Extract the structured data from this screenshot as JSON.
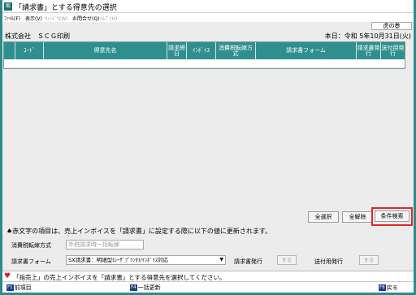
{
  "window": {
    "icon_label": "販",
    "title": "「請求書」とする得意先の選択"
  },
  "menu": {
    "file": "ﾌｧｲﾙ(F)",
    "view": "表示(V)",
    "window": "ｳｨﾝﾄﾞｳ(W)",
    "inquiry": "お問合せ(Q)",
    "help": "ﾍﾙﾌﾟ(H)"
  },
  "header": {
    "tiger_label": "虎の巻",
    "company": "株式会社　ＳＣＧ印刷",
    "date": "本日：令和 5年10月31日(火)"
  },
  "table": {
    "columns": [
      "ｺｰﾄﾞ",
      "得意先名",
      "請求締日",
      "ｲﾝﾎﾞｲｽ",
      "消費税転嫁方式",
      "請求書フォーム",
      "請求書発行",
      "送付用発行"
    ],
    "rows": []
  },
  "buttons": {
    "select_all": "全選択",
    "clear_all": "全解除",
    "condition_search": "条件検索"
  },
  "notice": "♠赤文字の項目は、売上インボイスを「請求書」に設定する際に以下の値に更新されます。",
  "form": {
    "tax_method_label": "消費税転嫁方式",
    "tax_method_value": "外税請求時一括転嫁",
    "invoice_form_label": "請求書フォーム",
    "invoice_form_value": "SX請求書：明細型(ﾚｰｻﾞﾌﾟﾘﾝﾀ)/ｲﾝﾎﾞｲｽ対応",
    "invoice_issue_label": "請求書発行",
    "invoice_issue_value": "する",
    "send_issue_label": "送付用発行",
    "send_issue_value": "する"
  },
  "status": {
    "message": "「指売上」の売上インボイスを「請求書」とする得意先を選択してください。"
  },
  "fkeys": {
    "f1_key": "F1",
    "f1_label": "前項目",
    "f4_key": "F4",
    "f4_label": "一括更新",
    "f8_key": "F8",
    "f8_label": "戻る"
  },
  "colors": {
    "title_teal": "#2e8b8b",
    "header_teal": "#2f8f8f",
    "highlight_red": "#e0262a",
    "fkey_blue": "#1c3b8f"
  }
}
